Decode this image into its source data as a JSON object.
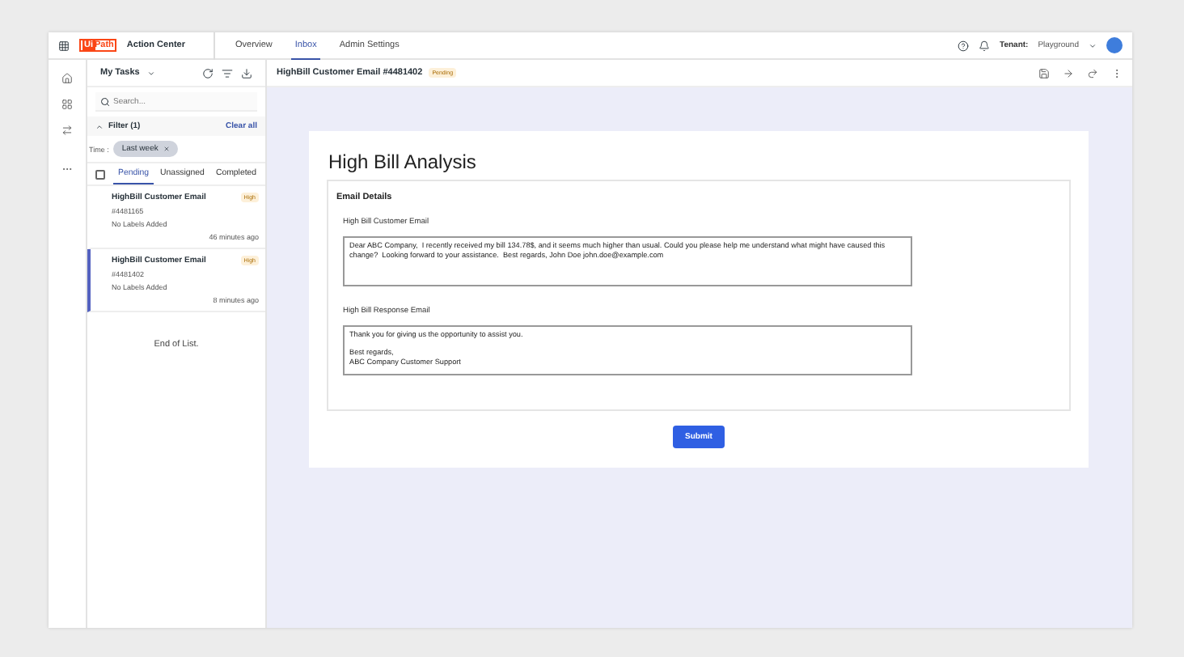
{
  "app": {
    "logo_mark": "Ui",
    "logo_text": "Path",
    "product": "Action Center"
  },
  "nav": [
    {
      "label": "Overview",
      "selected": false
    },
    {
      "label": "Inbox",
      "selected": true
    },
    {
      "label": "Admin Settings",
      "selected": false
    }
  ],
  "tenant": {
    "label": "Tenant:",
    "value": "Playground"
  },
  "task_panel": {
    "title": "My Tasks",
    "search": {
      "placeholder": "Search..."
    },
    "filter": {
      "label": "Filter (1)",
      "expanded": true,
      "clear": "Clear all"
    },
    "time_label": "Time :",
    "chip": "Last week",
    "select_all": {
      "checked": false
    },
    "tabs": [
      {
        "label": "Pending",
        "selected": true
      },
      {
        "label": "Unassigned",
        "selected": false
      },
      {
        "label": "Completed",
        "selected": false
      }
    ],
    "tasks": [
      {
        "title": "HighBill Customer Email",
        "priority": "High",
        "id": "#4481165",
        "labels": "No Labels Added",
        "time": "46 minutes ago",
        "selected": false
      },
      {
        "title": "HighBill Customer Email",
        "priority": "High",
        "id": "#4481402",
        "labels": "No Labels Added",
        "time": "8 minutes ago",
        "selected": true
      }
    ],
    "end": "End of List."
  },
  "task_header": {
    "title": "HighBill Customer Email #4481402",
    "status": "Pending"
  },
  "form": {
    "title": "High Bill Analysis",
    "section": "Email Details",
    "fields": [
      {
        "label": "High Bill Customer Email",
        "value": "Dear ABC Company,  I recently received my bill 134.78$, and it seems much higher than usual. Could you please help me understand what might have caused this change?  Looking forward to your assistance.  Best regards, John Doe john.doe@example.com"
      },
      {
        "label": "High Bill Response Email",
        "value": "Thank you for giving us the opportunity to assist you.\n\nBest regards,\nABC Company Customer Support"
      }
    ],
    "submit": "Submit"
  }
}
